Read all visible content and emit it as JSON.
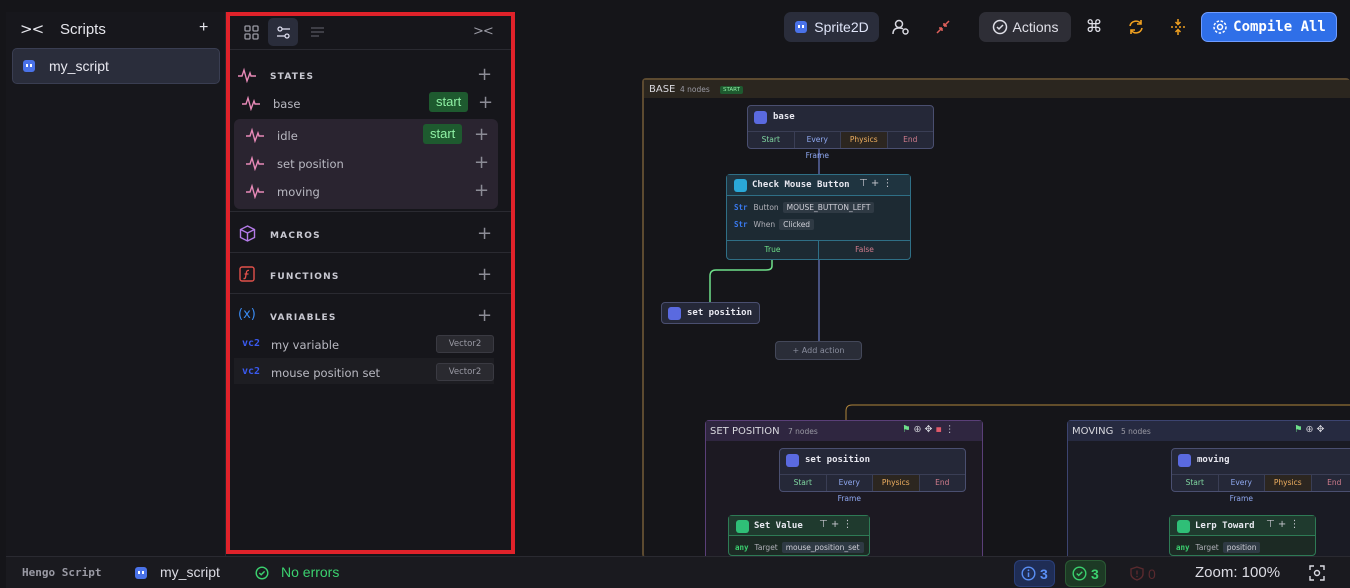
{
  "scripts_panel": {
    "title": "Scripts",
    "collapse_icon": "collapse-chevrons-icon",
    "add_label": "+",
    "items": [
      {
        "label": "my_script",
        "icon": "script-icon"
      }
    ]
  },
  "side_panel": {
    "tabs": [
      {
        "name": "grid",
        "icon": "grid-icon"
      },
      {
        "name": "nodes",
        "icon": "sliders-icon",
        "active": true
      },
      {
        "name": "text",
        "icon": "list-icon"
      }
    ],
    "collapse_icon": "collapse-chevrons-icon",
    "states": {
      "title": "STATES",
      "items": [
        {
          "label": "base",
          "badge": "start"
        },
        {
          "label": "idle",
          "badge": "start"
        },
        {
          "label": "set position",
          "badge": ""
        },
        {
          "label": "moving",
          "badge": ""
        }
      ]
    },
    "macros": {
      "title": "MACROS"
    },
    "functions": {
      "title": "FUNCTIONS"
    },
    "variables": {
      "title": "VARIABLES",
      "items": [
        {
          "type_tag": "vc2",
          "label": "my variable",
          "type": "Vector2"
        },
        {
          "type_tag": "vc2",
          "label": "mouse position set",
          "type": "Vector2"
        }
      ]
    }
  },
  "toolbar": {
    "object_label": "Sprite2D",
    "actions_label": "Actions",
    "compile_label": "Compile All",
    "colors": {
      "compile_bg": "#2f6fe8",
      "accent_orange": "#f0a020"
    }
  },
  "canvas": {
    "base_group": {
      "title": "BASE",
      "count": "4 nodes",
      "badge": "START",
      "state_node": {
        "title": "base",
        "hooks": [
          "Start",
          "Every Frame",
          "Physics",
          "End"
        ]
      },
      "check_node": {
        "title": "Check Mouse Button",
        "params": [
          {
            "type": "Str",
            "name": "Button",
            "value": "MOUSE_BUTTON_LEFT"
          },
          {
            "type": "Str",
            "name": "When",
            "value": "Clicked"
          }
        ],
        "outputs": [
          "True",
          "False"
        ]
      },
      "set_node": {
        "title": "set position"
      },
      "add_action": "Add action"
    },
    "set_group": {
      "title": "SET POSITION",
      "count": "7 nodes",
      "state_node": {
        "title": "set position",
        "hooks": [
          "Start",
          "Every Frame",
          "Physics",
          "End"
        ]
      },
      "value_node": {
        "title": "Set Value",
        "param": {
          "type": "any",
          "name": "Target",
          "value": "mouse_position_set"
        }
      }
    },
    "moving_group": {
      "title": "MOVING",
      "count": "5 nodes",
      "state_node": {
        "title": "moving",
        "hooks": [
          "Start",
          "Every Frame",
          "Physics",
          "End"
        ]
      },
      "lerp_node": {
        "title": "Lerp Toward",
        "param": {
          "type": "any",
          "name": "Target",
          "value": "position"
        }
      }
    }
  },
  "statusbar": {
    "app": "Hengo Script",
    "script": "my_script",
    "status": "No errors",
    "info_count": "3",
    "ok_count": "3",
    "error_count": "0",
    "zoom": "Zoom: 100%"
  }
}
